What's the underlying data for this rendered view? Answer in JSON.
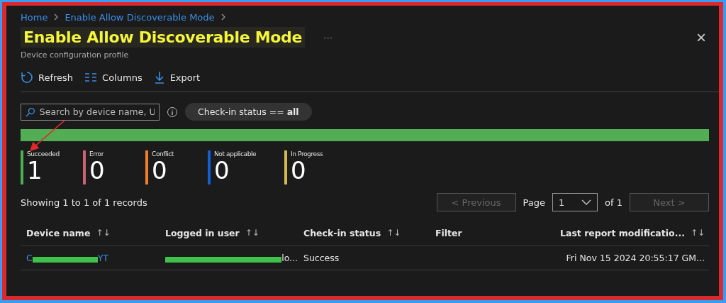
{
  "breadcrumb": [
    {
      "label": "Home"
    },
    {
      "label": "Enable Allow Discoverable Mode"
    }
  ],
  "title": "Enable Allow Discoverable Mode",
  "more": "···",
  "subtitle": "Device configuration profile",
  "toolbar": [
    {
      "kind": "refresh",
      "label": "Refresh"
    },
    {
      "kind": "columns",
      "label": "Columns"
    },
    {
      "kind": "export",
      "label": "Export"
    }
  ],
  "search": {
    "placeholder": "Search by device name, U"
  },
  "filter_pill": {
    "text": "Check-in status == **all**"
  },
  "status_bar": {
    "level": 1
  },
  "stats": [
    {
      "label": "Succeeded",
      "count": "1",
      "color": "#4caf50"
    },
    {
      "label": "Error",
      "count": "0",
      "color": "#d0616e"
    },
    {
      "label": "Conflict",
      "count": "0",
      "color": "#f07c2c"
    },
    {
      "label": "Not applicable",
      "count": "0",
      "color": "#1060d8"
    },
    {
      "label": "In Progress",
      "count": "0",
      "color": "#d4b84a"
    }
  ],
  "records": "Showing 1 to 1 of 1 records",
  "pagination": {
    "previous": "< Previous",
    "page_label": "Page",
    "page": "1",
    "of": "of 1",
    "next": "Next >",
    "previous_disabled": true,
    "next_disabled": true
  },
  "table": {
    "columns": [
      {
        "label": "Device name",
        "sort": "↑↓"
      },
      {
        "label": "Logged in user",
        "sort": "↑↓"
      },
      {
        "label": "Check-in status",
        "sort": "↑↓"
      },
      {
        "label": "Filter"
      },
      {
        "label": "Last report modificatio...",
        "sort": "↑↓"
      }
    ],
    "rows": [
      {
        "device": {
          "before": "C",
          "after": "YT"
        },
        "user": {
          "after": "lo..."
        },
        "status": "Success",
        "last_report": "Fri Nov 15 2024 20:55:17 GM..."
      }
    ]
  },
  "close": "×"
}
